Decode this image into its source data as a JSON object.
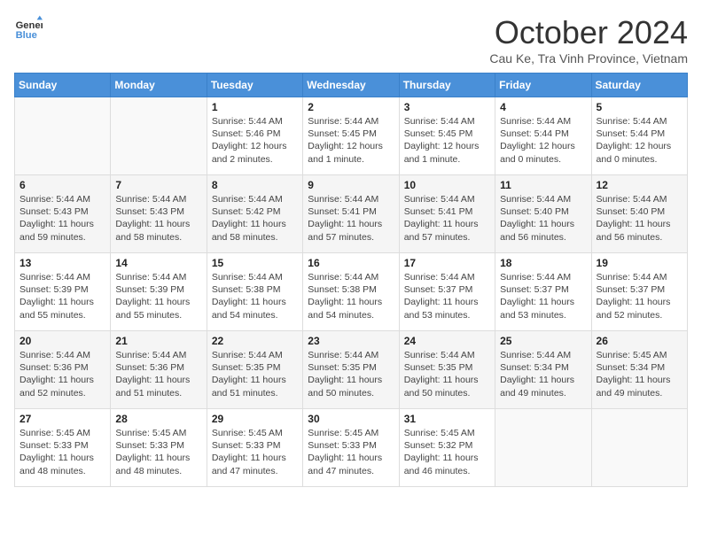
{
  "logo": {
    "line1": "General",
    "line2": "Blue"
  },
  "header": {
    "month": "October 2024",
    "location": "Cau Ke, Tra Vinh Province, Vietnam"
  },
  "weekdays": [
    "Sunday",
    "Monday",
    "Tuesday",
    "Wednesday",
    "Thursday",
    "Friday",
    "Saturday"
  ],
  "weeks": [
    [
      {
        "day": "",
        "info": ""
      },
      {
        "day": "",
        "info": ""
      },
      {
        "day": "1",
        "info": "Sunrise: 5:44 AM\nSunset: 5:46 PM\nDaylight: 12 hours\nand 2 minutes."
      },
      {
        "day": "2",
        "info": "Sunrise: 5:44 AM\nSunset: 5:45 PM\nDaylight: 12 hours\nand 1 minute."
      },
      {
        "day": "3",
        "info": "Sunrise: 5:44 AM\nSunset: 5:45 PM\nDaylight: 12 hours\nand 1 minute."
      },
      {
        "day": "4",
        "info": "Sunrise: 5:44 AM\nSunset: 5:44 PM\nDaylight: 12 hours\nand 0 minutes."
      },
      {
        "day": "5",
        "info": "Sunrise: 5:44 AM\nSunset: 5:44 PM\nDaylight: 12 hours\nand 0 minutes."
      }
    ],
    [
      {
        "day": "6",
        "info": "Sunrise: 5:44 AM\nSunset: 5:43 PM\nDaylight: 11 hours\nand 59 minutes."
      },
      {
        "day": "7",
        "info": "Sunrise: 5:44 AM\nSunset: 5:43 PM\nDaylight: 11 hours\nand 58 minutes."
      },
      {
        "day": "8",
        "info": "Sunrise: 5:44 AM\nSunset: 5:42 PM\nDaylight: 11 hours\nand 58 minutes."
      },
      {
        "day": "9",
        "info": "Sunrise: 5:44 AM\nSunset: 5:41 PM\nDaylight: 11 hours\nand 57 minutes."
      },
      {
        "day": "10",
        "info": "Sunrise: 5:44 AM\nSunset: 5:41 PM\nDaylight: 11 hours\nand 57 minutes."
      },
      {
        "day": "11",
        "info": "Sunrise: 5:44 AM\nSunset: 5:40 PM\nDaylight: 11 hours\nand 56 minutes."
      },
      {
        "day": "12",
        "info": "Sunrise: 5:44 AM\nSunset: 5:40 PM\nDaylight: 11 hours\nand 56 minutes."
      }
    ],
    [
      {
        "day": "13",
        "info": "Sunrise: 5:44 AM\nSunset: 5:39 PM\nDaylight: 11 hours\nand 55 minutes."
      },
      {
        "day": "14",
        "info": "Sunrise: 5:44 AM\nSunset: 5:39 PM\nDaylight: 11 hours\nand 55 minutes."
      },
      {
        "day": "15",
        "info": "Sunrise: 5:44 AM\nSunset: 5:38 PM\nDaylight: 11 hours\nand 54 minutes."
      },
      {
        "day": "16",
        "info": "Sunrise: 5:44 AM\nSunset: 5:38 PM\nDaylight: 11 hours\nand 54 minutes."
      },
      {
        "day": "17",
        "info": "Sunrise: 5:44 AM\nSunset: 5:37 PM\nDaylight: 11 hours\nand 53 minutes."
      },
      {
        "day": "18",
        "info": "Sunrise: 5:44 AM\nSunset: 5:37 PM\nDaylight: 11 hours\nand 53 minutes."
      },
      {
        "day": "19",
        "info": "Sunrise: 5:44 AM\nSunset: 5:37 PM\nDaylight: 11 hours\nand 52 minutes."
      }
    ],
    [
      {
        "day": "20",
        "info": "Sunrise: 5:44 AM\nSunset: 5:36 PM\nDaylight: 11 hours\nand 52 minutes."
      },
      {
        "day": "21",
        "info": "Sunrise: 5:44 AM\nSunset: 5:36 PM\nDaylight: 11 hours\nand 51 minutes."
      },
      {
        "day": "22",
        "info": "Sunrise: 5:44 AM\nSunset: 5:35 PM\nDaylight: 11 hours\nand 51 minutes."
      },
      {
        "day": "23",
        "info": "Sunrise: 5:44 AM\nSunset: 5:35 PM\nDaylight: 11 hours\nand 50 minutes."
      },
      {
        "day": "24",
        "info": "Sunrise: 5:44 AM\nSunset: 5:35 PM\nDaylight: 11 hours\nand 50 minutes."
      },
      {
        "day": "25",
        "info": "Sunrise: 5:44 AM\nSunset: 5:34 PM\nDaylight: 11 hours\nand 49 minutes."
      },
      {
        "day": "26",
        "info": "Sunrise: 5:45 AM\nSunset: 5:34 PM\nDaylight: 11 hours\nand 49 minutes."
      }
    ],
    [
      {
        "day": "27",
        "info": "Sunrise: 5:45 AM\nSunset: 5:33 PM\nDaylight: 11 hours\nand 48 minutes."
      },
      {
        "day": "28",
        "info": "Sunrise: 5:45 AM\nSunset: 5:33 PM\nDaylight: 11 hours\nand 48 minutes."
      },
      {
        "day": "29",
        "info": "Sunrise: 5:45 AM\nSunset: 5:33 PM\nDaylight: 11 hours\nand 47 minutes."
      },
      {
        "day": "30",
        "info": "Sunrise: 5:45 AM\nSunset: 5:33 PM\nDaylight: 11 hours\nand 47 minutes."
      },
      {
        "day": "31",
        "info": "Sunrise: 5:45 AM\nSunset: 5:32 PM\nDaylight: 11 hours\nand 46 minutes."
      },
      {
        "day": "",
        "info": ""
      },
      {
        "day": "",
        "info": ""
      }
    ]
  ]
}
